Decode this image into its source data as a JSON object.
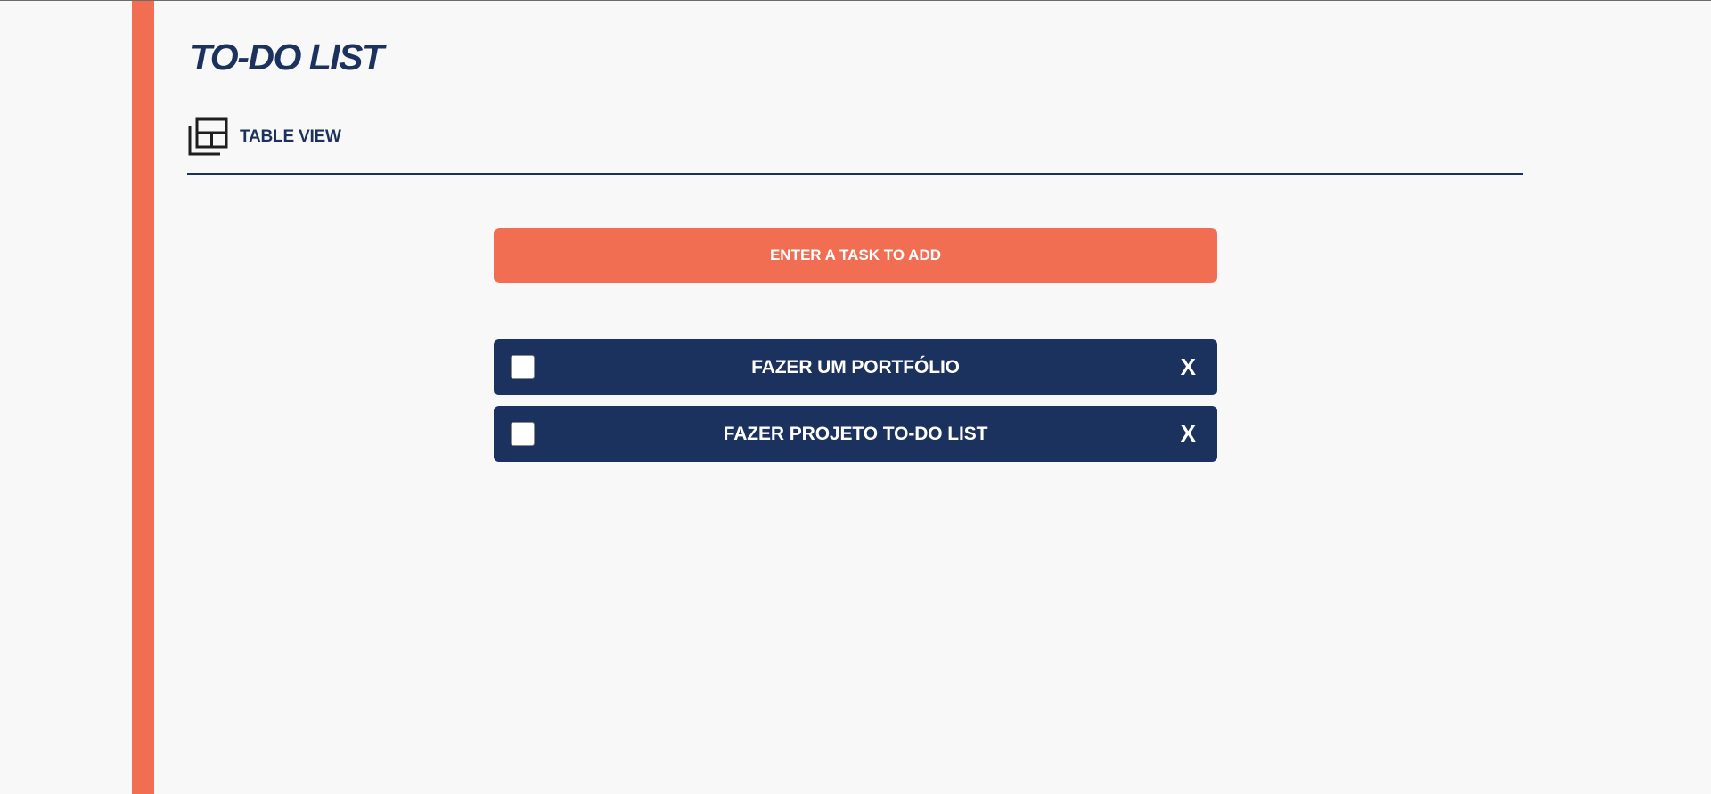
{
  "app": {
    "title": "TO-DO LIST"
  },
  "view_toggle": {
    "label": "TABLE VIEW",
    "icon": "table-layout-icon"
  },
  "input": {
    "placeholder": "ENTER A TASK TO ADD",
    "value": ""
  },
  "tasks": [
    {
      "text": "FAZER UM PORTFÓLIO",
      "checked": false,
      "delete_label": "X"
    },
    {
      "text": "FAZER PROJETO TO-DO LIST",
      "checked": false,
      "delete_label": "X"
    }
  ],
  "colors": {
    "accent": "#f26e52",
    "primary": "#1c325e",
    "background": "#f8f8f9"
  }
}
